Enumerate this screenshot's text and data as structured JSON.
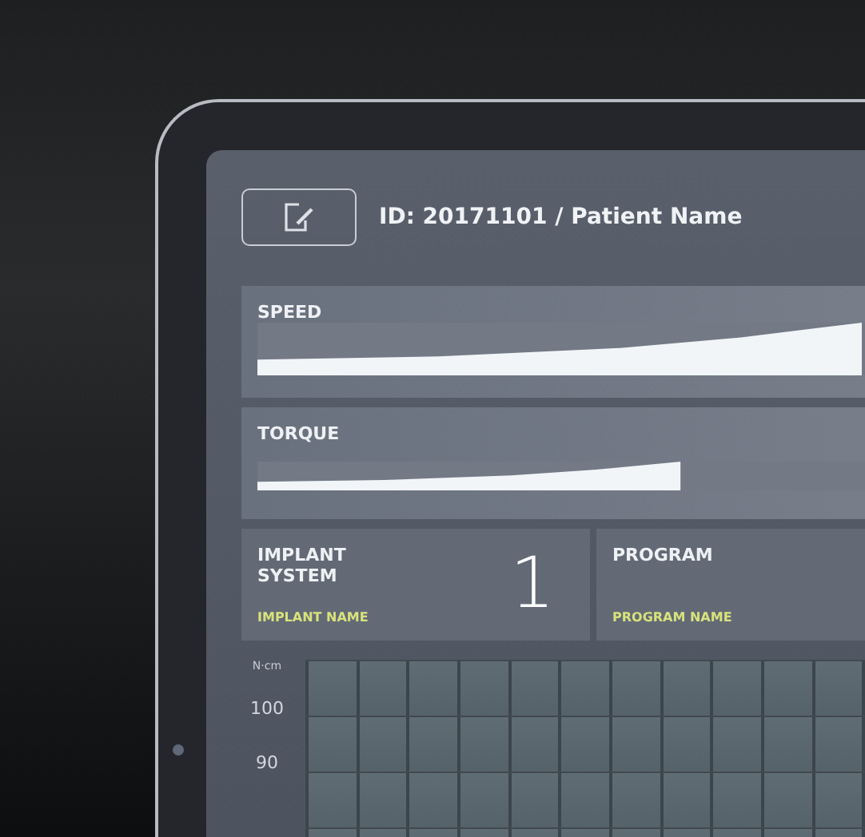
{
  "header": {
    "patient_label": "ID: 20171101 / Patient Name"
  },
  "meters": [
    {
      "label": "SPEED",
      "level": 0.9
    },
    {
      "label": "TORQUE",
      "level": 0.63
    }
  ],
  "info_cards": [
    {
      "title": "IMPLANT SYSTEM",
      "number": "1",
      "subtitle": "IMPLANT NAME"
    },
    {
      "title": "PROGRAM",
      "subtitle": "PROGRAM NAME"
    }
  ],
  "graph": {
    "unit": "N·cm",
    "ticks": [
      "100",
      "90"
    ]
  }
}
